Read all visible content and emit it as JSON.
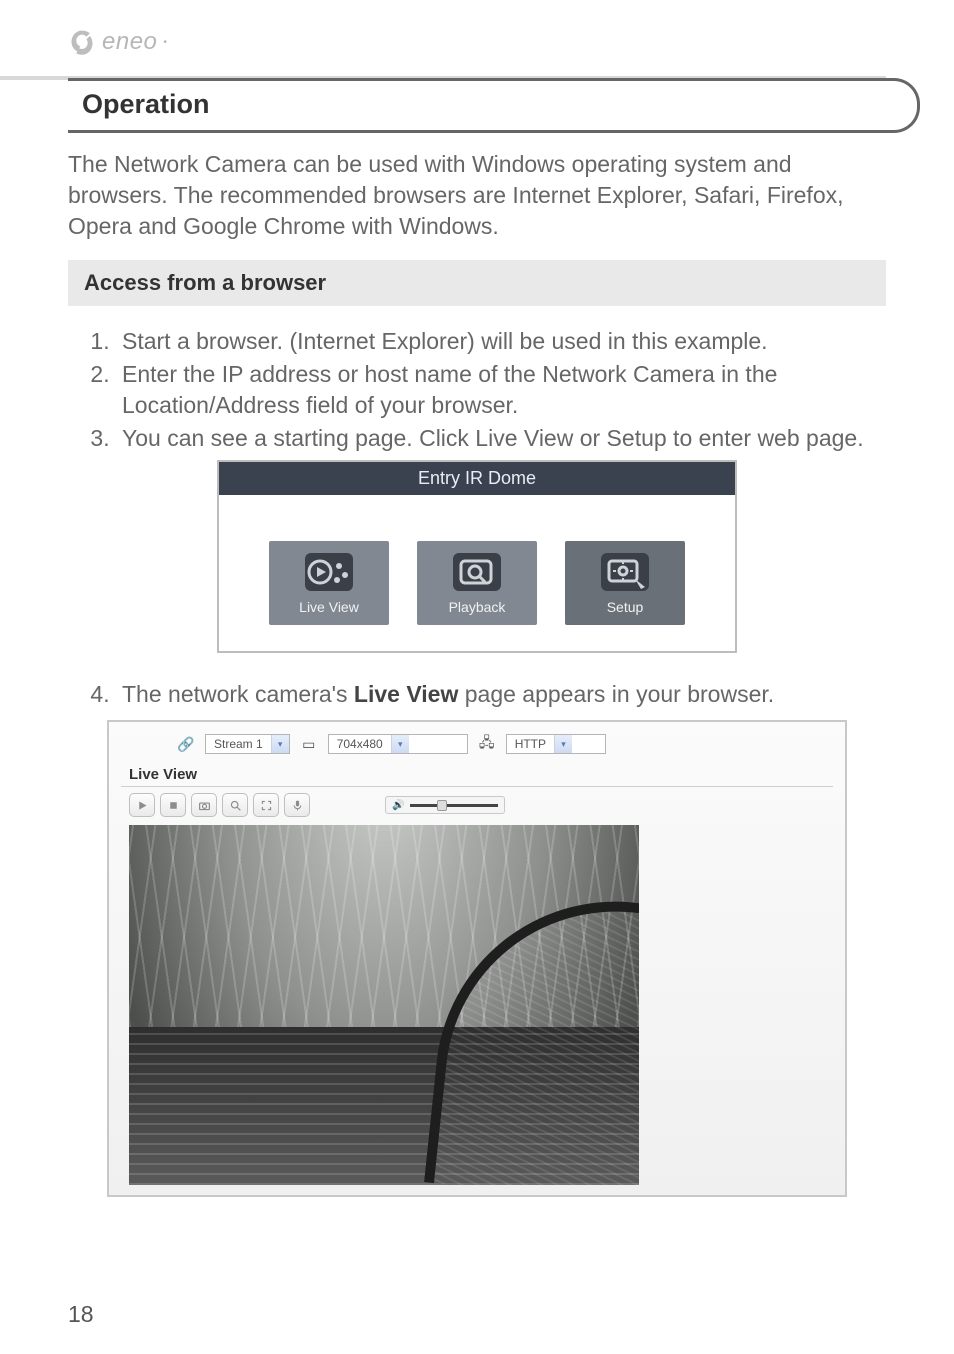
{
  "brand": "eneo",
  "heading": "Operation",
  "intro": "The Network Camera can be used with Windows operating system and browsers. The recommended browsers are Internet Explorer, Safari, Firefox, Opera and Google Chrome with Windows.",
  "sub_heading": "Access from a browser",
  "steps": [
    "Start a browser. (Internet Explorer) will be used in this example.",
    "Enter the IP address or host name of the Network Camera in the Location/Address field of your browser.",
    "You can see a starting page. Click Live View or Setup to enter web page."
  ],
  "shot1": {
    "title": "Entry IR Dome",
    "tiles": [
      "Live View",
      "Playback",
      "Setup"
    ]
  },
  "step4_pre": "The network camera's ",
  "step4_bold": "Live View",
  "step4_post": " page appears in your browser.",
  "shot2": {
    "stream": "Stream 1",
    "res": "704x480",
    "proto": "HTTP",
    "heading": "Live View"
  },
  "page_number": "18"
}
